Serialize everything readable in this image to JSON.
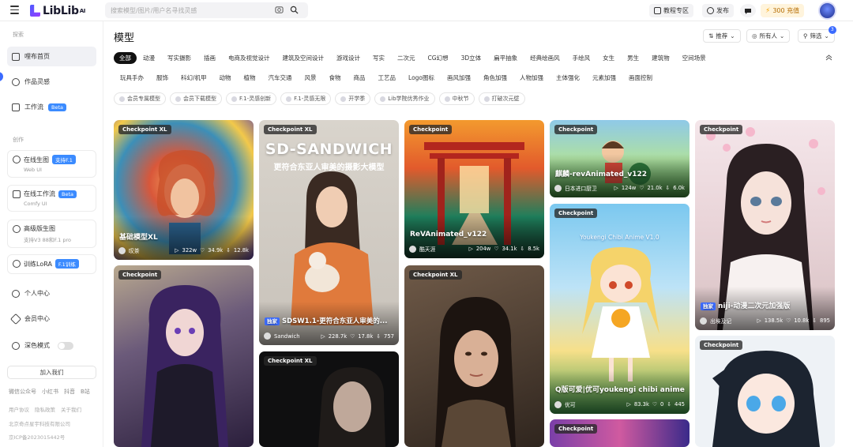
{
  "header": {
    "logo": "LibLib",
    "logo_sup": "AI",
    "search_placeholder": "搜索模型/图片/用户名寻找灵感",
    "tutorial": "教程专区",
    "publish": "发布",
    "recharge": "300 充值"
  },
  "sidebar": {
    "sec_explore": "探索",
    "nav": [
      "哩布首页",
      "作品灵感",
      "工作流"
    ],
    "workflow_badge": "Beta",
    "sec_create": "创作",
    "cards": [
      {
        "title": "在线生图",
        "badge": "支持F.1",
        "sub": "Web UI"
      },
      {
        "title": "在线工作流",
        "badge": "Beta",
        "sub": "Comfy UI"
      },
      {
        "title": "高级版生图",
        "badge": "",
        "sub": "支持V3 88和F.1 pro"
      },
      {
        "title": "训练LoRA",
        "badge": "F.1训练",
        "sub": ""
      }
    ],
    "personal": "个人中心",
    "member": "会员中心",
    "dark_mode": "深色模式",
    "join": "加入我们",
    "social": [
      "微信公众号",
      "小红书",
      "抖音",
      "B站"
    ],
    "legal": [
      "用户协议",
      "隐私政策",
      "关于我们"
    ],
    "company": "北京奇点星宇科技有限公司",
    "icp": "京ICP备2023015442号"
  },
  "main": {
    "title": "模型",
    "sort": "推荐",
    "owner": "所有人",
    "filter": "筛选",
    "filter_count": "3",
    "tags": [
      "全部",
      "动漫",
      "写实摄影",
      "插画",
      "电商及视觉设计",
      "建筑及空间设计",
      "游戏设计",
      "写实",
      "二次元",
      "CG幻想",
      "3D立体",
      "扁平抽象",
      "经典绘画风",
      "手绘风",
      "女生",
      "男生",
      "建筑物",
      "空间场景",
      "玩具手办",
      "服饰",
      "科幻/机甲",
      "动物",
      "植物",
      "汽车交通",
      "风景",
      "食物",
      "商品",
      "工艺品",
      "Logo图标",
      "画风加强",
      "角色加强",
      "人物加强",
      "主体强化",
      "元素加强",
      "画面控制"
    ],
    "pills": [
      "会员专属模型",
      "会员下载模型",
      "F.1-灵感创新",
      "F.1-灵感无限",
      "开学季",
      "Lib学院优秀作业",
      "中秋节",
      "打破次元壁"
    ]
  },
  "cards": [
    {
      "label": "Checkpoint  XL",
      "title": "基础模型XL",
      "author": "叹茶",
      "views": "322w",
      "likes": "34.9k",
      "dl": "12.8k"
    },
    {
      "label": "Checkpoint  XL",
      "title": "SDSW1.1-更符合东亚人审美的...",
      "author": "Sandwich",
      "views": "228.7k",
      "likes": "17.8k",
      "dl": "757",
      "exclusive": "独家",
      "poster_title": "SD-SANDWICH",
      "poster_sub": "更符合东亚人审美的摄影大模型"
    },
    {
      "label": "Checkpoint",
      "title": "ReVAnimated_v122",
      "author": "酷天涯",
      "views": "204w",
      "likes": "34.1k",
      "dl": "8.5k"
    },
    {
      "label": "Checkpoint",
      "title": "麒麟-revAnimated_v122",
      "author": "日本进口厨卫",
      "views": "124w",
      "likes": "21.0k",
      "dl": "6.0k"
    },
    {
      "label": "Checkpoint",
      "title": "niji-动漫二次元加强版",
      "author": "出埃及记",
      "views": "138.5k",
      "likes": "10.8k",
      "dl": "895",
      "exclusive": "独家"
    },
    {
      "label": "Checkpoint",
      "title": "",
      "author": "",
      "views": "",
      "likes": "",
      "dl": ""
    },
    {
      "label": "Checkpoint  XL",
      "title": "",
      "author": "",
      "views": "",
      "likes": "",
      "dl": ""
    },
    {
      "label": "Checkpoint  XL",
      "title": "",
      "author": "",
      "views": "",
      "likes": "",
      "dl": ""
    },
    {
      "label": "Checkpoint",
      "title": "Q版可爱|优可youkengi chibi anime",
      "author": "优可",
      "views": "83.3k",
      "likes": "0",
      "dl": "445",
      "poster_title": "Youkengi Chibi Anime V1.0"
    },
    {
      "label": "Checkpoint",
      "title": "",
      "author": "",
      "views": "",
      "likes": "",
      "dl": ""
    },
    {
      "label": "Checkpoint",
      "title": "",
      "author": "",
      "views": "",
      "likes": "",
      "dl": ""
    }
  ]
}
